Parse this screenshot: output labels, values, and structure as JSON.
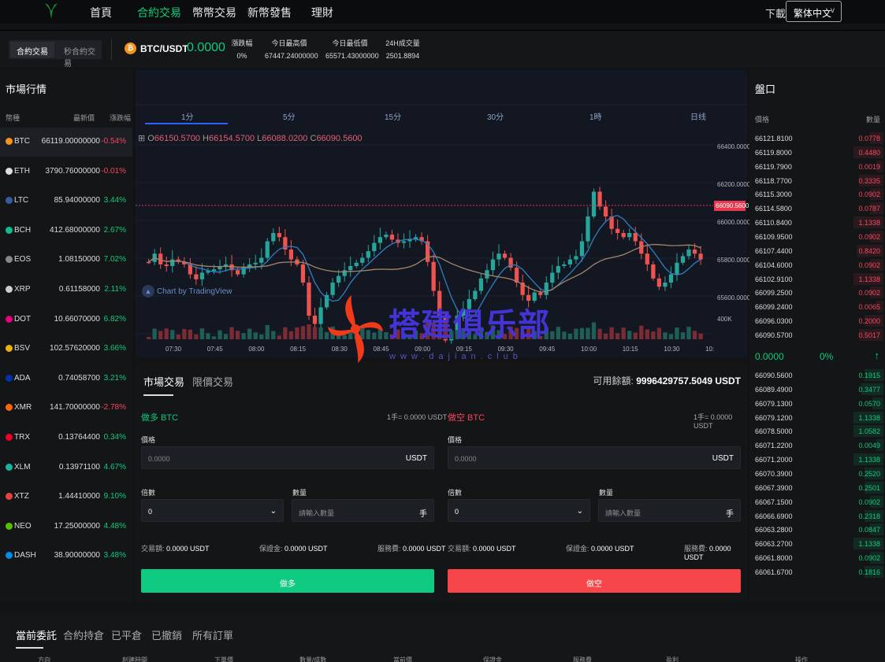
{
  "nav": {
    "items": [
      "首頁",
      "合約交易",
      "幣幣交易",
      "新幣發售",
      "理財"
    ],
    "active_index": 1,
    "download": "下載",
    "language": "繁体中文"
  },
  "ticker": {
    "modes": [
      "合約交易",
      "秒合約交易"
    ],
    "pair": "BTC/USDT",
    "price": "0.0000",
    "change_label": "漲跌幅",
    "change_value": "0%",
    "high_label": "今日最高價",
    "high_value": "67447.24000000",
    "low_label": "今日最低價",
    "low_value": "65571.43000000",
    "vol_label": "24H成交量",
    "vol_value": "2501.8894"
  },
  "market": {
    "title": "市場行情",
    "headers": [
      "幣種",
      "最新價",
      "漲跌幅"
    ],
    "rows": [
      {
        "sym": "BTC",
        "price": "66119.00000000",
        "chg": "-0.54%",
        "dir": "down",
        "color": "#f7931a"
      },
      {
        "sym": "ETH",
        "price": "3790.76000000",
        "chg": "-0.01%",
        "dir": "down",
        "color": "#dddddd"
      },
      {
        "sym": "LTC",
        "price": "85.94000000",
        "chg": "3.44%",
        "dir": "up",
        "color": "#345d9d"
      },
      {
        "sym": "BCH",
        "price": "412.68000000",
        "chg": "2.67%",
        "dir": "up",
        "color": "#0ac18e"
      },
      {
        "sym": "EOS",
        "price": "1.08150000",
        "chg": "7.02%",
        "dir": "up",
        "color": "#888888"
      },
      {
        "sym": "XRP",
        "price": "0.61158000",
        "chg": "2.11%",
        "dir": "up",
        "color": "#cccccc"
      },
      {
        "sym": "DOT",
        "price": "10.66070000",
        "chg": "6.82%",
        "dir": "up",
        "color": "#e6007a"
      },
      {
        "sym": "BSV",
        "price": "102.57620000",
        "chg": "3.66%",
        "dir": "up",
        "color": "#eab300"
      },
      {
        "sym": "ADA",
        "price": "0.74058700",
        "chg": "3.21%",
        "dir": "up",
        "color": "#0033ad"
      },
      {
        "sym": "XMR",
        "price": "141.70000000",
        "chg": "-2.78%",
        "dir": "down",
        "color": "#ff6600"
      },
      {
        "sym": "TRX",
        "price": "0.13764400",
        "chg": "0.34%",
        "dir": "up",
        "color": "#ef0027"
      },
      {
        "sym": "XLM",
        "price": "0.13971100",
        "chg": "4.67%",
        "dir": "up",
        "color": "#14b6a0"
      },
      {
        "sym": "XTZ",
        "price": "1.44410000",
        "chg": "9.10%",
        "dir": "up",
        "color": "#e84142"
      },
      {
        "sym": "NEO",
        "price": "17.25000000",
        "chg": "4.48%",
        "dir": "up",
        "color": "#58bf00"
      },
      {
        "sym": "DASH",
        "price": "38.90000000",
        "chg": "3.48%",
        "dir": "up",
        "color": "#008ce7"
      }
    ]
  },
  "chart": {
    "timeframes": [
      "1分",
      "5分",
      "15分",
      "30分",
      "1時",
      "日线"
    ],
    "active_tf": 0,
    "ohlc": {
      "o": "66150.5700",
      "h": "66154.5700",
      "l": "66088.0200",
      "c": "66090.5600"
    },
    "tv_label": "Chart by TradingView",
    "y_labels": [
      "66400.0000",
      "66200.0000",
      "66000.0000",
      "65800.0000",
      "65600.0000"
    ],
    "vol_label": "400K",
    "last_price": "66090.5600",
    "x_labels": [
      "07:30",
      "07:45",
      "08:00",
      "08:15",
      "08:30",
      "08:45",
      "09:00",
      "09:15",
      "09:30",
      "09:45",
      "10:00",
      "10:15",
      "10:30",
      "10:"
    ]
  },
  "orderbook": {
    "title": "盤口",
    "headers": [
      "價格",
      "數量"
    ],
    "asks": [
      {
        "price": "66121.8100",
        "qty": "0.0778",
        "fill": 0.1
      },
      {
        "price": "66119.8000",
        "qty": "0.4480",
        "fill": 0.22
      },
      {
        "price": "66119.7900",
        "qty": "0.0019",
        "fill": 0.05
      },
      {
        "price": "66118.7700",
        "qty": "0.3335",
        "fill": 0.18
      },
      {
        "price": "66115.3000",
        "qty": "0.0902",
        "fill": 0.1
      },
      {
        "price": "66114.5800",
        "qty": "0.0787",
        "fill": 0.1
      },
      {
        "price": "66110.8400",
        "qty": "1.1338",
        "fill": 0.22
      },
      {
        "price": "66109.9500",
        "qty": "0.0902",
        "fill": 0.1
      },
      {
        "price": "66107.4400",
        "qty": "0.8420",
        "fill": 0.2
      },
      {
        "price": "66104.6000",
        "qty": "0.0902",
        "fill": 0.1
      },
      {
        "price": "66102.9100",
        "qty": "1.1338",
        "fill": 0.22
      },
      {
        "price": "66099.2500",
        "qty": "0.0902",
        "fill": 0.1
      },
      {
        "price": "66099.2400",
        "qty": "0.0065",
        "fill": 0.05
      },
      {
        "price": "66096.0300",
        "qty": "0.2000",
        "fill": 0.14
      },
      {
        "price": "66090.5700",
        "qty": "0.5017",
        "fill": 0.18
      }
    ],
    "last": "0.0000",
    "last_pct": "0%",
    "bids": [
      {
        "price": "66090.5600",
        "qty": "0.1915",
        "fill": 0.14
      },
      {
        "price": "66089.4900",
        "qty": "0.3477",
        "fill": 0.16
      },
      {
        "price": "66079.1300",
        "qty": "0.0570",
        "fill": 0.08
      },
      {
        "price": "66079.1200",
        "qty": "1.1338",
        "fill": 0.22
      },
      {
        "price": "66078.5000",
        "qty": "1.0582",
        "fill": 0.22
      },
      {
        "price": "66071.2200",
        "qty": "0.0049",
        "fill": 0.05
      },
      {
        "price": "66071.2000",
        "qty": "1.1338",
        "fill": 0.22
      },
      {
        "price": "66070.3900",
        "qty": "0.2520",
        "fill": 0.14
      },
      {
        "price": "66067.3900",
        "qty": "0.2501",
        "fill": 0.14
      },
      {
        "price": "66067.1500",
        "qty": "0.0902",
        "fill": 0.1
      },
      {
        "price": "66066.6900",
        "qty": "0.2318",
        "fill": 0.14
      },
      {
        "price": "66063.2800",
        "qty": "0.0847",
        "fill": 0.1
      },
      {
        "price": "66063.2700",
        "qty": "1.1338",
        "fill": 0.22
      },
      {
        "price": "66061.8000",
        "qty": "0.0902",
        "fill": 0.1
      },
      {
        "price": "66061.6700",
        "qty": "0.1816",
        "fill": 0.14
      }
    ]
  },
  "trade": {
    "tabs": [
      "市場交易",
      "限價交易"
    ],
    "balance_label": "可用餘額:",
    "balance_value": "9996429757.5049 USDT",
    "long": {
      "title": "做多 BTC",
      "unit_note": "1手= 0.0000 USDT",
      "price_label": "價格",
      "price_value": "0.0000",
      "price_suffix": "USDT",
      "lev_label": "倍數",
      "lev_value": "0",
      "qty_label": "數量",
      "qty_placeholder": "請輸入數量",
      "qty_suffix": "手",
      "amount_label": "交易額:",
      "amount_value": "0.0000 USDT",
      "margin_label": "保證金:",
      "margin_value": "0.0000 USDT",
      "fee_label": "服務費:",
      "fee_value": "0.0000 USDT",
      "button": "做多"
    },
    "short": {
      "title": "做空 BTC",
      "unit_note": "1手= 0.0000 USDT",
      "price_label": "價格",
      "price_value": "0.0000",
      "price_suffix": "USDT",
      "lev_label": "倍數",
      "lev_value": "0",
      "qty_label": "數量",
      "qty_placeholder": "請輸入數量",
      "qty_suffix": "手",
      "amount_label": "交易額:",
      "amount_value": "0.0000 USDT",
      "margin_label": "保證金:",
      "margin_value": "0.0000 USDT",
      "fee_label": "服務費:",
      "fee_value": "0.0000 USDT",
      "button": "做空"
    }
  },
  "bottom": {
    "tabs": [
      "當前委託",
      "合約持倉",
      "已平倉",
      "已撤銷",
      "所有訂單"
    ],
    "columns": [
      "方向",
      "創建時間",
      "下單價",
      "數量/成數",
      "當前價",
      "保證金",
      "服務費",
      "盈利",
      "操作"
    ]
  },
  "watermark": {
    "text": "搭建俱乐部",
    "url": "www.dajian.club"
  },
  "colors": {
    "up": "#0ecb81",
    "down": "#f6465d",
    "accent": "#0ecb81"
  }
}
